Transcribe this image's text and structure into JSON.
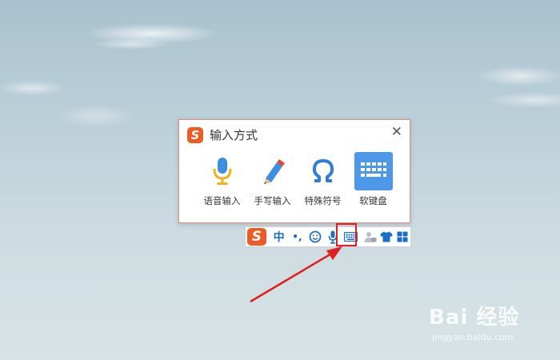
{
  "popup": {
    "title": "输入方式",
    "close_label": "✕",
    "options": [
      {
        "label": "语音输入",
        "icon": "microphone-icon",
        "active": false
      },
      {
        "label": "手写输入",
        "icon": "pencil-icon",
        "active": false
      },
      {
        "label": "特殊符号",
        "icon": "omega-icon",
        "active": false
      },
      {
        "label": "软键盘",
        "icon": "soft-keyboard-icon",
        "active": true
      }
    ]
  },
  "logo_letter": "S",
  "toolbar": {
    "chinese_mode": "中",
    "punctuation": "•,",
    "icons": [
      "emoji-icon",
      "microphone-icon",
      "keyboard-icon",
      "user-icon",
      "skin-icon",
      "toolbox-icon"
    ]
  },
  "watermark": {
    "main": "Bai 经验",
    "sub": "jingyan.baidu.com"
  },
  "colors": {
    "accent": "#4e98ea",
    "brand_orange": "#ee5a24",
    "toolbar_blue": "#1a6fc4",
    "highlight_red": "#e02020"
  }
}
